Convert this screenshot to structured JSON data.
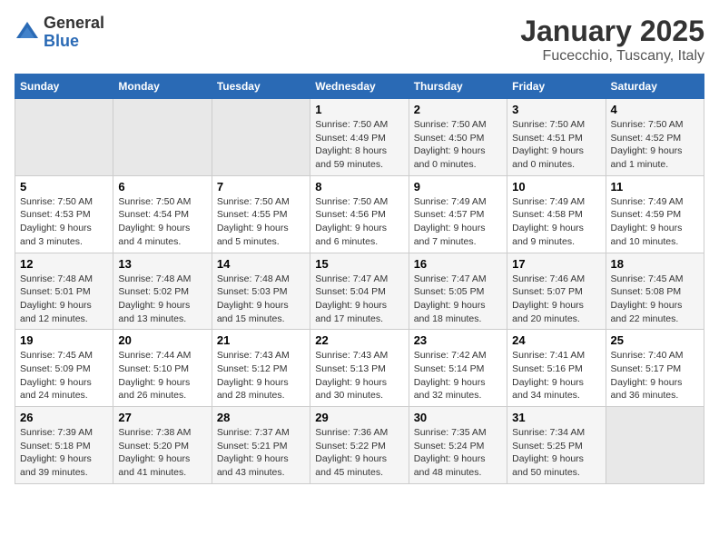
{
  "logo": {
    "general": "General",
    "blue": "Blue"
  },
  "header": {
    "title": "January 2025",
    "subtitle": "Fucecchio, Tuscany, Italy"
  },
  "days_of_week": [
    "Sunday",
    "Monday",
    "Tuesday",
    "Wednesday",
    "Thursday",
    "Friday",
    "Saturday"
  ],
  "weeks": [
    [
      {
        "day": "",
        "info": ""
      },
      {
        "day": "",
        "info": ""
      },
      {
        "day": "",
        "info": ""
      },
      {
        "day": "1",
        "info": "Sunrise: 7:50 AM\nSunset: 4:49 PM\nDaylight: 8 hours\nand 59 minutes."
      },
      {
        "day": "2",
        "info": "Sunrise: 7:50 AM\nSunset: 4:50 PM\nDaylight: 9 hours\nand 0 minutes."
      },
      {
        "day": "3",
        "info": "Sunrise: 7:50 AM\nSunset: 4:51 PM\nDaylight: 9 hours\nand 0 minutes."
      },
      {
        "day": "4",
        "info": "Sunrise: 7:50 AM\nSunset: 4:52 PM\nDaylight: 9 hours\nand 1 minute."
      }
    ],
    [
      {
        "day": "5",
        "info": "Sunrise: 7:50 AM\nSunset: 4:53 PM\nDaylight: 9 hours\nand 3 minutes."
      },
      {
        "day": "6",
        "info": "Sunrise: 7:50 AM\nSunset: 4:54 PM\nDaylight: 9 hours\nand 4 minutes."
      },
      {
        "day": "7",
        "info": "Sunrise: 7:50 AM\nSunset: 4:55 PM\nDaylight: 9 hours\nand 5 minutes."
      },
      {
        "day": "8",
        "info": "Sunrise: 7:50 AM\nSunset: 4:56 PM\nDaylight: 9 hours\nand 6 minutes."
      },
      {
        "day": "9",
        "info": "Sunrise: 7:49 AM\nSunset: 4:57 PM\nDaylight: 9 hours\nand 7 minutes."
      },
      {
        "day": "10",
        "info": "Sunrise: 7:49 AM\nSunset: 4:58 PM\nDaylight: 9 hours\nand 9 minutes."
      },
      {
        "day": "11",
        "info": "Sunrise: 7:49 AM\nSunset: 4:59 PM\nDaylight: 9 hours\nand 10 minutes."
      }
    ],
    [
      {
        "day": "12",
        "info": "Sunrise: 7:48 AM\nSunset: 5:01 PM\nDaylight: 9 hours\nand 12 minutes."
      },
      {
        "day": "13",
        "info": "Sunrise: 7:48 AM\nSunset: 5:02 PM\nDaylight: 9 hours\nand 13 minutes."
      },
      {
        "day": "14",
        "info": "Sunrise: 7:48 AM\nSunset: 5:03 PM\nDaylight: 9 hours\nand 15 minutes."
      },
      {
        "day": "15",
        "info": "Sunrise: 7:47 AM\nSunset: 5:04 PM\nDaylight: 9 hours\nand 17 minutes."
      },
      {
        "day": "16",
        "info": "Sunrise: 7:47 AM\nSunset: 5:05 PM\nDaylight: 9 hours\nand 18 minutes."
      },
      {
        "day": "17",
        "info": "Sunrise: 7:46 AM\nSunset: 5:07 PM\nDaylight: 9 hours\nand 20 minutes."
      },
      {
        "day": "18",
        "info": "Sunrise: 7:45 AM\nSunset: 5:08 PM\nDaylight: 9 hours\nand 22 minutes."
      }
    ],
    [
      {
        "day": "19",
        "info": "Sunrise: 7:45 AM\nSunset: 5:09 PM\nDaylight: 9 hours\nand 24 minutes."
      },
      {
        "day": "20",
        "info": "Sunrise: 7:44 AM\nSunset: 5:10 PM\nDaylight: 9 hours\nand 26 minutes."
      },
      {
        "day": "21",
        "info": "Sunrise: 7:43 AM\nSunset: 5:12 PM\nDaylight: 9 hours\nand 28 minutes."
      },
      {
        "day": "22",
        "info": "Sunrise: 7:43 AM\nSunset: 5:13 PM\nDaylight: 9 hours\nand 30 minutes."
      },
      {
        "day": "23",
        "info": "Sunrise: 7:42 AM\nSunset: 5:14 PM\nDaylight: 9 hours\nand 32 minutes."
      },
      {
        "day": "24",
        "info": "Sunrise: 7:41 AM\nSunset: 5:16 PM\nDaylight: 9 hours\nand 34 minutes."
      },
      {
        "day": "25",
        "info": "Sunrise: 7:40 AM\nSunset: 5:17 PM\nDaylight: 9 hours\nand 36 minutes."
      }
    ],
    [
      {
        "day": "26",
        "info": "Sunrise: 7:39 AM\nSunset: 5:18 PM\nDaylight: 9 hours\nand 39 minutes."
      },
      {
        "day": "27",
        "info": "Sunrise: 7:38 AM\nSunset: 5:20 PM\nDaylight: 9 hours\nand 41 minutes."
      },
      {
        "day": "28",
        "info": "Sunrise: 7:37 AM\nSunset: 5:21 PM\nDaylight: 9 hours\nand 43 minutes."
      },
      {
        "day": "29",
        "info": "Sunrise: 7:36 AM\nSunset: 5:22 PM\nDaylight: 9 hours\nand 45 minutes."
      },
      {
        "day": "30",
        "info": "Sunrise: 7:35 AM\nSunset: 5:24 PM\nDaylight: 9 hours\nand 48 minutes."
      },
      {
        "day": "31",
        "info": "Sunrise: 7:34 AM\nSunset: 5:25 PM\nDaylight: 9 hours\nand 50 minutes."
      },
      {
        "day": "",
        "info": ""
      }
    ]
  ]
}
